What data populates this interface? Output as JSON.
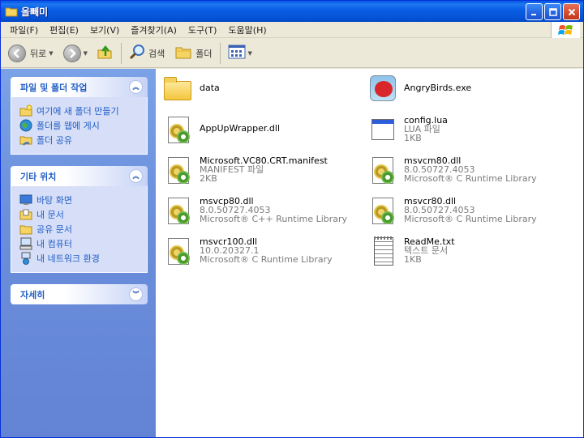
{
  "window": {
    "title": "올빼미"
  },
  "menu": [
    "파일(F)",
    "편집(E)",
    "보기(V)",
    "즐겨찾기(A)",
    "도구(T)",
    "도움말(H)"
  ],
  "toolbar": {
    "back": "뒤로",
    "search": "검색",
    "folders": "폴더"
  },
  "taskpane": {
    "groups": [
      {
        "title": "파일 및 폴더 작업",
        "items": [
          "여기에 새 폴더 만들기",
          "폴더를 웹에 게시",
          "폴더 공유"
        ]
      },
      {
        "title": "기타 위치",
        "items": [
          "바탕 화면",
          "내 문서",
          "공유 문서",
          "내 컴퓨터",
          "내 네트워크 환경"
        ]
      },
      {
        "title": "자세히",
        "items": []
      }
    ]
  },
  "files": [
    {
      "name": "data",
      "l1": "",
      "l2": "",
      "icon": "folder-icon"
    },
    {
      "name": "AngryBirds.exe",
      "l1": "",
      "l2": "",
      "icon": "angrybirds-icon"
    },
    {
      "name": "AppUpWrapper.dll",
      "l1": "",
      "l2": "",
      "icon": "dll-icon"
    },
    {
      "name": "config.lua",
      "l1": "LUA 파일",
      "l2": "1KB",
      "icon": "lua-file-icon"
    },
    {
      "name": "Microsoft.VC80.CRT.manifest",
      "l1": "MANIFEST 파일",
      "l2": "2KB",
      "icon": "manifest-icon"
    },
    {
      "name": "msvcm80.dll",
      "l1": "8.0.50727.4053",
      "l2": "Microsoft® C Runtime Library",
      "icon": "dll-icon"
    },
    {
      "name": "msvcp80.dll",
      "l1": "8.0.50727.4053",
      "l2": "Microsoft® C++ Runtime Library",
      "icon": "dll-icon"
    },
    {
      "name": "msvcr80.dll",
      "l1": "8.0.50727.4053",
      "l2": "Microsoft® C Runtime Library",
      "icon": "dll-icon"
    },
    {
      "name": "msvcr100.dll",
      "l1": "10.0.20327.1",
      "l2": "Microsoft® C Runtime Library",
      "icon": "dll-icon"
    },
    {
      "name": "ReadMe.txt",
      "l1": "텍스트 문서",
      "l2": "1KB",
      "icon": "text-file-icon"
    }
  ]
}
